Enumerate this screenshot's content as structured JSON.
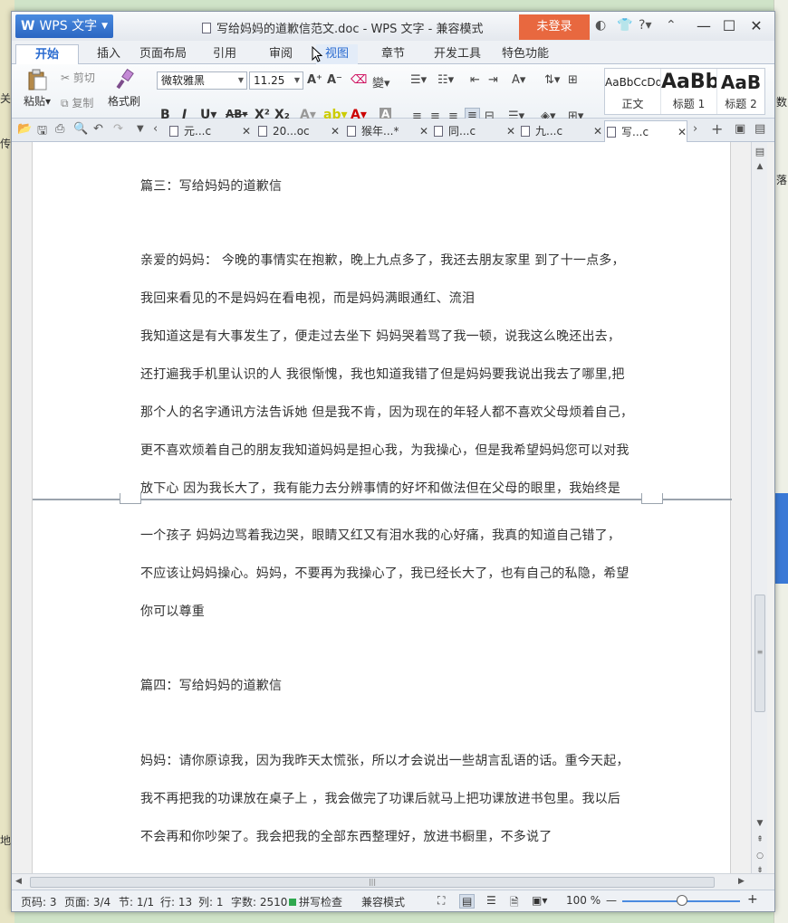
{
  "background": {
    "left_labels": [
      "关",
      "传",
      "地"
    ],
    "right_labels": [
      "落",
      "数"
    ]
  },
  "app": {
    "name": "WPS 文字",
    "doc_title": "写给妈妈的道歉信范文.doc - WPS 文字 - 兼容模式",
    "login_label": "未登录",
    "help_label": "?"
  },
  "menu_tabs": [
    "开始",
    "插入",
    "页面布局",
    "引用",
    "审阅",
    "视图",
    "章节",
    "开发工具",
    "特色功能"
  ],
  "ribbon": {
    "paste": "粘贴",
    "cut": "剪切",
    "copy": "复制",
    "format_painter": "格式刷",
    "font_name": "微软雅黑",
    "font_size": "11.25",
    "styles": [
      {
        "preview": "AaBbCcDd",
        "name": "正文"
      },
      {
        "preview": "AaBb",
        "name": "标题 1"
      },
      {
        "preview": "AaB",
        "name": "标题 2"
      }
    ]
  },
  "doc_tabs": [
    {
      "label": "元...c",
      "active": false
    },
    {
      "label": "20...oc",
      "active": false
    },
    {
      "label": "猴年...*",
      "active": false
    },
    {
      "label": "同...c",
      "active": false
    },
    {
      "label": "九...c",
      "active": false
    },
    {
      "label": "写...c",
      "active": true
    }
  ],
  "document": {
    "lines": [
      "篇三：写给妈妈的道歉信",
      "亲爱的妈妈： 今晚的事情实在抱歉，晚上九点多了，我还去朋友家里 到了十一点多，",
      "我回来看见的不是妈妈在看电视，而是妈妈满眼通红、流泪",
      " 我知道这是有大事发生了，便走过去坐下 妈妈哭着骂了我一顿，说我这么晚还出去，",
      "还打遍我手机里认识的人 我很惭愧，我也知道我错了但是妈妈要我说出我去了哪里,把",
      "那个人的名字通讯方法告诉她 但是我不肯，因为现在的年轻人都不喜欢父母烦着自己，",
      "更不喜欢烦着自己的朋友我知道妈妈是担心我，为我操心，但是我希望妈妈您可以对我",
      "放下心 因为我长大了，我有能力去分辨事情的好坏和做法但在父母的眼里，我始终是",
      "一个孩子 妈妈边骂着我边哭，眼睛又红又有泪水我的心好痛，我真的知道自己错了，",
      "不应该让妈妈操心。妈妈，不要再为我操心了，我已经长大了，也有自己的私隐，希望",
      "你可以尊重",
      "篇四：写给妈妈的道歉信",
      "妈妈：请你原谅我，因为我昨天太慌张，所以才会说出一些胡言乱语的话。重今天起，",
      "我不再把我的功课放在桌子上 ，我会做完了功课后就马上把功课放进书包里。我以后",
      "不会再和你吵架了。我会把我的全部东西整理好，放进书橱里，不多说了"
    ]
  },
  "status": {
    "page_code": "页码: 3",
    "pages": "页面: 3/4",
    "section": "节: 1/1",
    "row": "行: 13",
    "col": "列: 1",
    "words": "字数: 2510",
    "spell": "拼写检查",
    "mode": "兼容模式",
    "zoom": "100 %"
  },
  "colors": {
    "accent": "#2b66c2",
    "login": "#e8683f"
  }
}
